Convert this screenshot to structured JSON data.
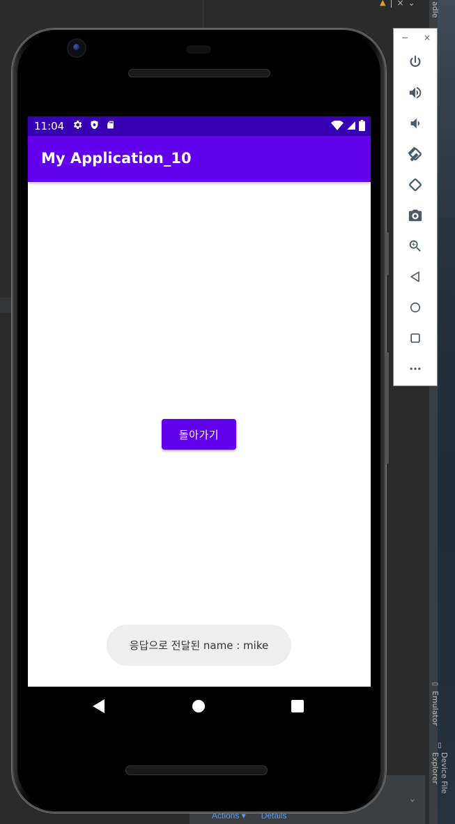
{
  "ide": {
    "right_tabs": [
      "Emulator",
      "Device File Explorer"
    ],
    "bottom_links": [
      "Actions ▾",
      "Details"
    ],
    "top_right_text": "adle"
  },
  "phone": {
    "status_bar": {
      "time": "11:04"
    },
    "app_bar": {
      "title": "My Application_10"
    },
    "content": {
      "back_button_label": "돌아가기"
    },
    "toast": {
      "message": "응답으로 전달된 name : mike"
    },
    "nav": {
      "back": "back-icon",
      "home": "home-icon",
      "recents": "recents-icon"
    }
  },
  "emulator_toolbar": {
    "window_controls": [
      "−",
      "×"
    ],
    "buttons": [
      "power-icon",
      "volume-up-icon",
      "volume-down-icon",
      "rotate-left-icon",
      "rotate-right-icon",
      "camera-icon",
      "zoom-icon",
      "back-icon",
      "home-icon",
      "overview-icon",
      "more-icon"
    ]
  },
  "colors": {
    "status_bar": "#3700b3",
    "app_bar": "#6200ee",
    "button": "#6200ee",
    "toast_bg": "#eeeeee",
    "ide_bg": "#2b2b2b",
    "toolbar_icon": "#4a5a66"
  }
}
